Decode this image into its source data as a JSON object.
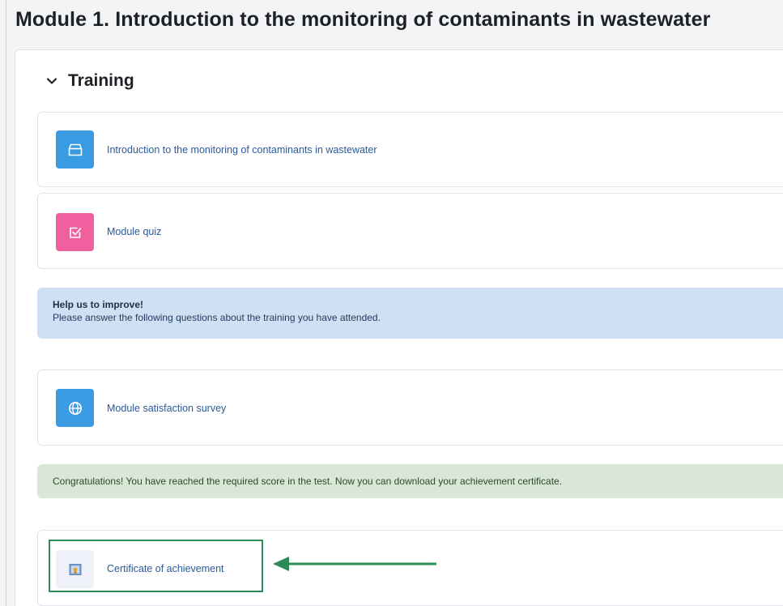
{
  "page": {
    "title": "Module 1. Introduction to the monitoring of contaminants in wastewater"
  },
  "section": {
    "title": "Training",
    "collapse_icon": "chevron-down-icon"
  },
  "activities": [
    {
      "label": "Introduction to the monitoring of contaminants in wastewater",
      "icon": "box-icon",
      "icon_color": "#399be2"
    },
    {
      "label": "Module quiz",
      "icon": "checkbox-icon",
      "icon_color": "#f0609e"
    },
    {
      "label": "Module satisfaction survey",
      "icon": "globe-icon",
      "icon_color": "#399be2"
    },
    {
      "label": "Certificate of achievement",
      "icon": "certificate-icon",
      "icon_color": "#eef2f8"
    }
  ],
  "info_alert": {
    "title": "Help us to improve!",
    "text": "Please answer the following questions about the training you have attended."
  },
  "success_alert": {
    "text": "Congratulations! You have reached the required score in the test. Now you can download your achievement certificate."
  },
  "annotation": {
    "highlight_color": "#2e8b57",
    "arrow_color": "#2e8b57"
  }
}
